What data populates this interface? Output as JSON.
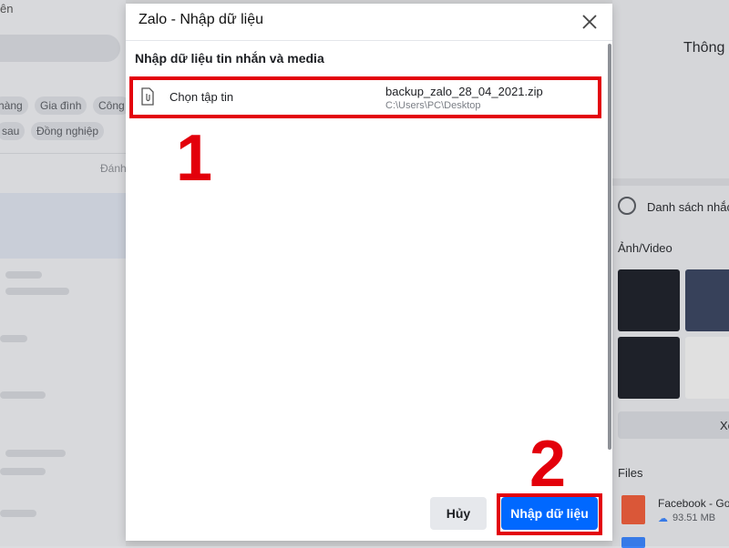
{
  "background": {
    "left_title": "ên",
    "chips": [
      "hàng",
      "Gia đình",
      "Công",
      "sau",
      "Đồng nghiệp"
    ],
    "sort_label": "Đánh",
    "right_header": "Thông",
    "reminders_label": "Danh sách nhắc",
    "media_label": "Ảnh/Video",
    "view_all_label": "Xe",
    "files_label": "Files",
    "file_item": {
      "name": "Facebook - Go",
      "size": "93.51 MB"
    }
  },
  "dialog": {
    "title": "Zalo - Nhập dữ liệu",
    "section_title": "Nhập dữ liệu tin nhắn và media",
    "choose_file_label": "Chọn tập tin",
    "file_name": "backup_zalo_28_04_2021.zip",
    "file_path": "C:\\Users\\PC\\Desktop",
    "cancel_label": "Hủy",
    "import_label": "Nhập dữ liệu"
  },
  "annotations": {
    "step1": "1",
    "step2": "2"
  },
  "colors": {
    "primary": "#0068ff",
    "annotation": "#e3000b"
  },
  "icons": [
    "close-icon",
    "file-attachment-icon",
    "alarm-clock-icon",
    "cloud-download-icon",
    "video-file-icon"
  ]
}
